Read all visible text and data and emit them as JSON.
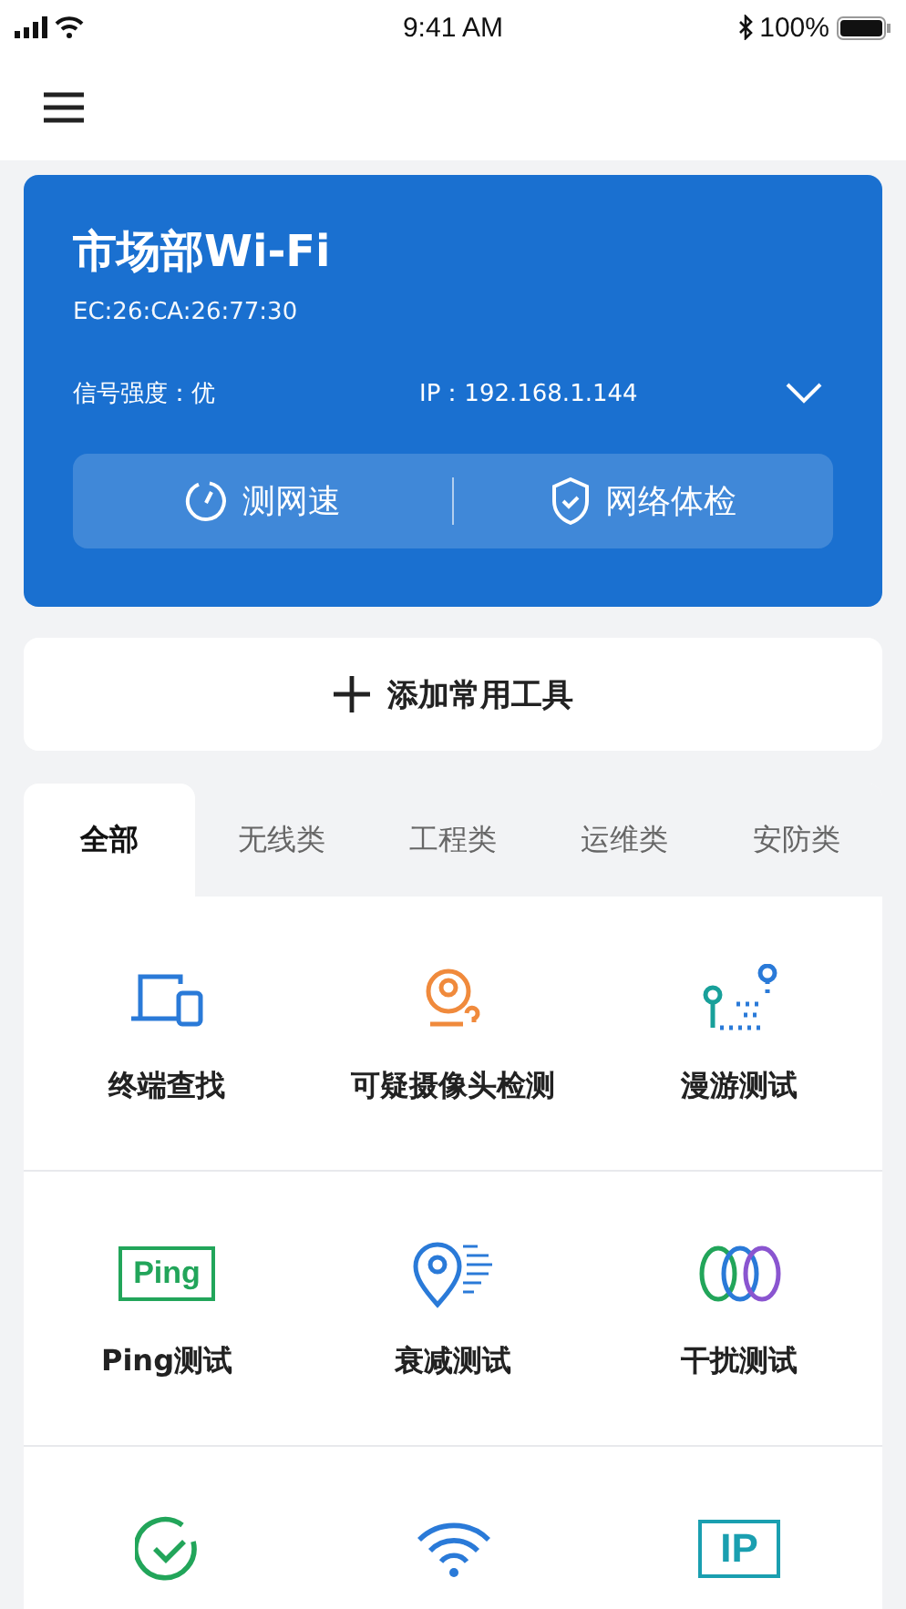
{
  "status_bar": {
    "time": "9:41 AM",
    "battery": "100%"
  },
  "wifi_card": {
    "ssid": "市场部Wi-Fi",
    "mac": "EC:26:CA:26:77:30",
    "signal": "信号强度：优",
    "ip": "IP：192.168.1.144",
    "expanded": false,
    "actions": [
      {
        "kind": "speed",
        "label": "测网速"
      },
      {
        "kind": "shield",
        "label": "网络体检"
      }
    ]
  },
  "add_tool": {
    "label": "添加常用工具"
  },
  "tabs": [
    {
      "label": "全部",
      "selected": true
    },
    {
      "label": "无线类",
      "selected": false
    },
    {
      "label": "工程类",
      "selected": false
    },
    {
      "label": "运维类",
      "selected": false
    },
    {
      "label": "安防类",
      "selected": false
    }
  ],
  "tools": [
    {
      "kind": "device",
      "label": "终端查找"
    },
    {
      "kind": "camera",
      "label": "可疑摄像头检测"
    },
    {
      "kind": "roam",
      "label": "漫游测试"
    },
    {
      "kind": "ping",
      "badge": "Ping",
      "label": "Ping测试"
    },
    {
      "kind": "pin",
      "label": "衰减测试"
    },
    {
      "kind": "rings",
      "label": "干扰测试"
    },
    {
      "kind": "check"
    },
    {
      "kind": "wifi"
    },
    {
      "kind": "ip",
      "badge": "IP"
    }
  ]
}
